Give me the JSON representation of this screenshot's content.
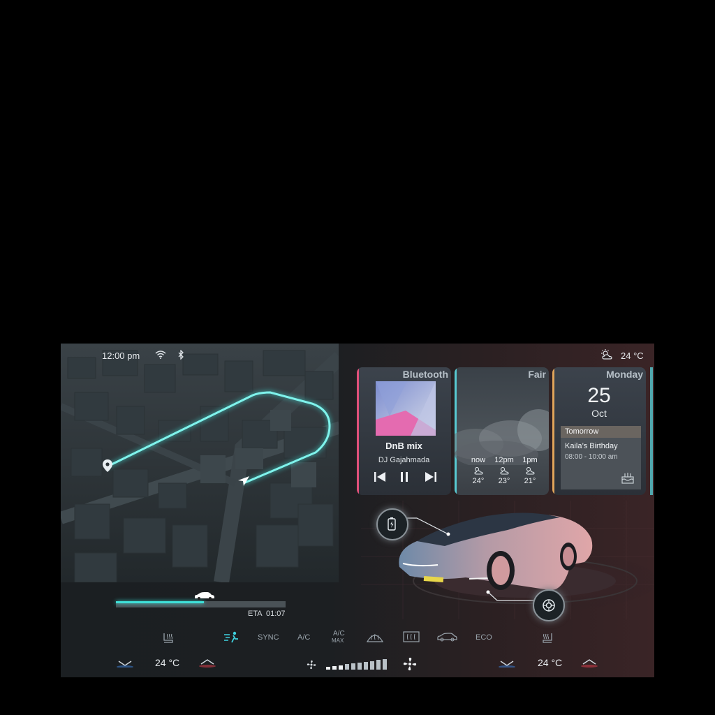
{
  "status": {
    "time": "12:00 pm",
    "outside_temp": "24 °C",
    "wifi_icon": "wifi-icon",
    "bluetooth_icon": "bluetooth-icon",
    "weather_icon": "partly-sunny-icon"
  },
  "navigation": {
    "eta_label": "ETA",
    "eta_time": "01:07",
    "progress": 0.52
  },
  "cards": {
    "media": {
      "title": "Bluetooth",
      "track": "DnB mix",
      "artist": "DJ Gajahmada",
      "accent": "#e0507a"
    },
    "weather": {
      "title": "Fair",
      "accent": "#58c9d1",
      "forecast": [
        {
          "time": "now",
          "temp": "24°"
        },
        {
          "time": "12pm",
          "temp": "23°"
        },
        {
          "time": "1pm",
          "temp": "21°"
        }
      ]
    },
    "calendar": {
      "title": "Monday",
      "day": "25",
      "month": "Oct",
      "section": "Tomorrow",
      "event": "Kaila’s Birthday",
      "event_time": "08:00 - 10:00 am",
      "accent": "#e0a45a"
    }
  },
  "climate": {
    "buttons": [
      "SYNC",
      "A/C",
      "A/C",
      "MAX",
      "ECO"
    ],
    "left_temp": "24 °C",
    "right_temp": "24 °C",
    "fan_level": 0.35
  },
  "colors": {
    "accent_cyan": "#3fe0d8",
    "accent_red": "#e8455a"
  }
}
